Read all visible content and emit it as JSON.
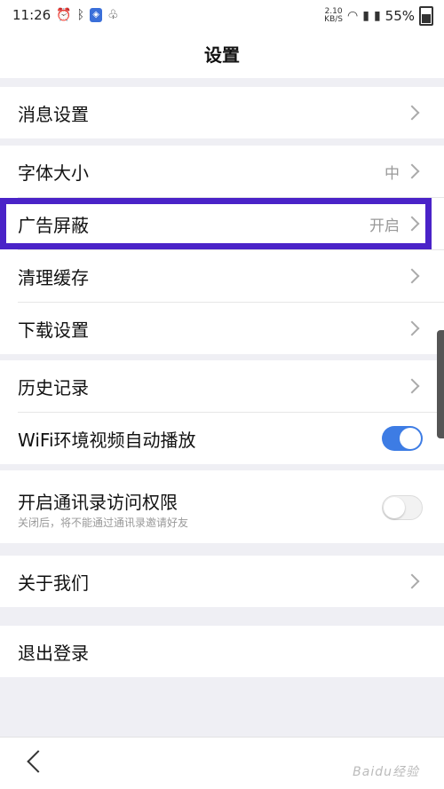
{
  "status_bar": {
    "time": "11:26",
    "net_speed_value": "2.10",
    "net_speed_unit": "KB/S",
    "battery": "55%"
  },
  "title": "设置",
  "sections": {
    "messages": {
      "label": "消息设置"
    },
    "font_size": {
      "label": "字体大小",
      "value": "中"
    },
    "ad_block": {
      "label": "广告屏蔽",
      "value": "开启"
    },
    "clear_cache": {
      "label": "清理缓存"
    },
    "download": {
      "label": "下载设置"
    },
    "history": {
      "label": "历史记录"
    },
    "wifi_autoplay": {
      "label": "WiFi环境视频自动播放",
      "enabled": true
    },
    "contacts": {
      "label": "开启通讯录访问权限",
      "hint": "关闭后，将不能通过通讯录邀请好友",
      "enabled": false
    },
    "about": {
      "label": "关于我们"
    },
    "logout": {
      "label": "退出登录"
    }
  },
  "watermark": "Baidu经验",
  "colors": {
    "highlight": "#4a23c8",
    "toggle_on": "#3d7ce4"
  }
}
